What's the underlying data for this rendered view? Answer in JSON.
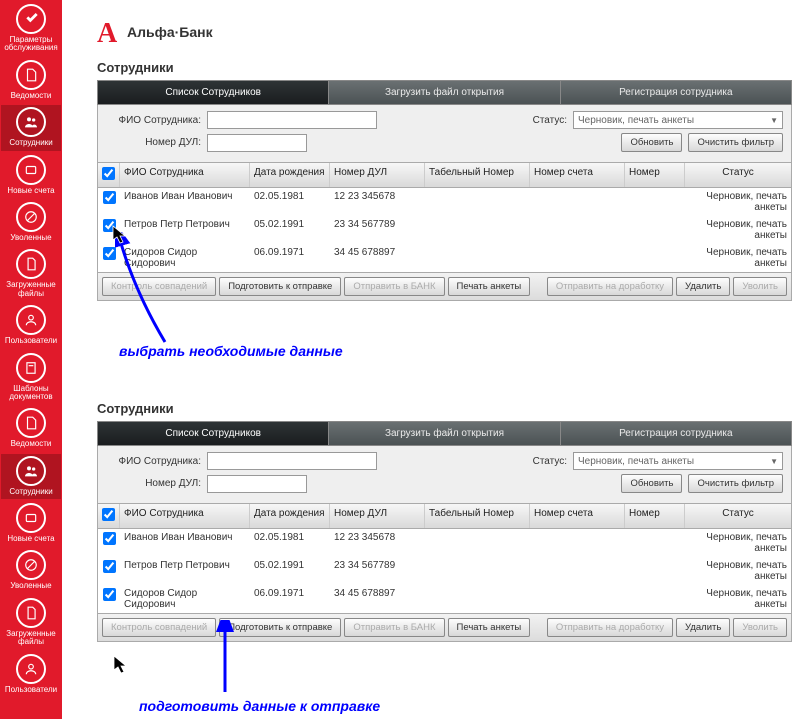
{
  "brand": {
    "name": "Альфа·Банк"
  },
  "sidebar": [
    {
      "label": "Параметры обслуживания",
      "icon": "tools"
    },
    {
      "label": "Ведомости",
      "icon": "doc"
    },
    {
      "label": "Сотрудники",
      "icon": "people",
      "active": true
    },
    {
      "label": "Новые счета",
      "icon": "accounts"
    },
    {
      "label": "Уволенные",
      "icon": "fired"
    },
    {
      "label": "Загруженные файлы",
      "icon": "file"
    },
    {
      "label": "Пользователи",
      "icon": "user"
    },
    {
      "label": "Шаблоны документов",
      "icon": "template"
    },
    {
      "label": "Ведомости",
      "icon": "doc"
    },
    {
      "label": "Сотрудники",
      "icon": "people",
      "active": true
    },
    {
      "label": "Новые счета",
      "icon": "accounts"
    },
    {
      "label": "Уволенные",
      "icon": "fired"
    },
    {
      "label": "Загруженные файлы",
      "icon": "file"
    },
    {
      "label": "Пользователи",
      "icon": "user"
    }
  ],
  "tabs": {
    "list": "Список Сотрудников",
    "upload": "Загрузить файл открытия",
    "register": "Регистрация сотрудника"
  },
  "filters": {
    "fio_label": "ФИО Сотрудника:",
    "dul_label": "Номер ДУЛ:",
    "status_label": "Статус:",
    "status_value": "Черновик, печать анкеты",
    "refresh": "Обновить",
    "clear": "Очистить фильтр"
  },
  "columns": {
    "fio": "ФИО Сотрудника",
    "dob": "Дата рождения",
    "dul": "Номер ДУЛ",
    "tab": "Табельный Номер",
    "acc": "Номер счета",
    "num": "Номер",
    "status": "Статус"
  },
  "rows": [
    {
      "fio": "Иванов Иван Иванович",
      "dob": "02.05.1981",
      "dul": "12 23 345678",
      "status": "Черновик, печать анкеты"
    },
    {
      "fio": "Петров Петр Петрович",
      "dob": "05.02.1991",
      "dul": "23 34 567789",
      "status": "Черновик, печать анкеты"
    },
    {
      "fio": "Сидоров Сидор Сидорович",
      "dob": "06.09.1971",
      "dul": "34 45 678897",
      "status": "Черновик, печать анкеты"
    }
  ],
  "actions": {
    "check": "Контроль совпадений",
    "prepare": "Подготовить к отправке",
    "send": "Отправить в БАНК",
    "print": "Печать анкеты",
    "revise": "Отправить на доработку",
    "delete": "Удалить",
    "fire": "Уволить"
  },
  "section_title": "Сотрудники",
  "annotations": {
    "a1": "выбрать необходимые данные",
    "a2": "подготовить данные к отправке"
  }
}
